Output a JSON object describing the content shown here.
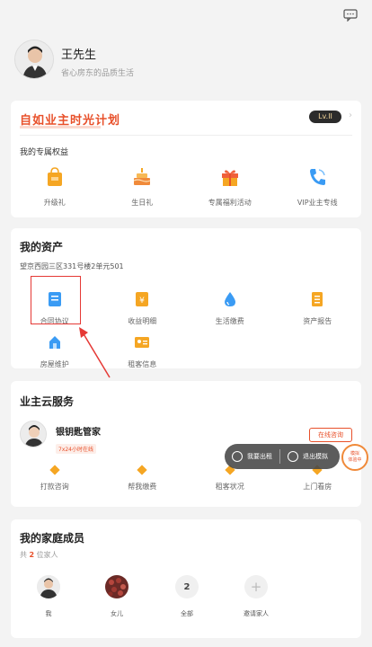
{
  "profile": {
    "name": "王先生",
    "subtitle": "省心房东的品质生活"
  },
  "owner_plan": {
    "title": "自如业主时光计划",
    "level": "Lv.II",
    "perks_title": "我的专属权益",
    "perks": [
      {
        "label": "升级礼",
        "icon": "gift-bag-icon"
      },
      {
        "label": "生日礼",
        "icon": "birthday-cake-icon"
      },
      {
        "label": "专属福利活动",
        "icon": "gift-box-icon"
      },
      {
        "label": "VIP业主专线",
        "icon": "phone-icon"
      }
    ]
  },
  "assets": {
    "title": "我的资产",
    "address": "望京西园三区331号楼2单元501",
    "items": [
      {
        "label": "合同协议",
        "icon": "contract-icon"
      },
      {
        "label": "收益明细",
        "icon": "income-icon"
      },
      {
        "label": "生活缴费",
        "icon": "utility-drop-icon"
      },
      {
        "label": "资产报告",
        "icon": "report-icon"
      },
      {
        "label": "房屋维护",
        "icon": "house-repair-icon"
      },
      {
        "label": "租客信息",
        "icon": "tenant-card-icon"
      }
    ]
  },
  "cloud_service": {
    "title": "业主云服务",
    "agent_name": "银钥匙管家",
    "agent_tag": "7x24小时在线",
    "consult_label": "在线咨询",
    "items": [
      {
        "label": "打款咨询"
      },
      {
        "label": "帮我缴费"
      },
      {
        "label": "租客状况"
      },
      {
        "label": "上门看房"
      }
    ]
  },
  "overlay": {
    "action1": "我要出租",
    "action2": "退出模拟",
    "badge_line1": "模拟",
    "badge_line2": "体验中"
  },
  "family": {
    "title": "我的家庭成员",
    "subtitle_prefix": "共",
    "count": "2",
    "subtitle_suffix": "位家人",
    "members": [
      {
        "label": "我"
      },
      {
        "label": "女儿"
      },
      {
        "label": "全部",
        "value": "2"
      },
      {
        "label": "邀请家人"
      }
    ]
  },
  "colors": {
    "accent": "#e8502a",
    "orange": "#f5a623",
    "blue": "#3a9bf4",
    "highlight_red": "#e53935"
  }
}
